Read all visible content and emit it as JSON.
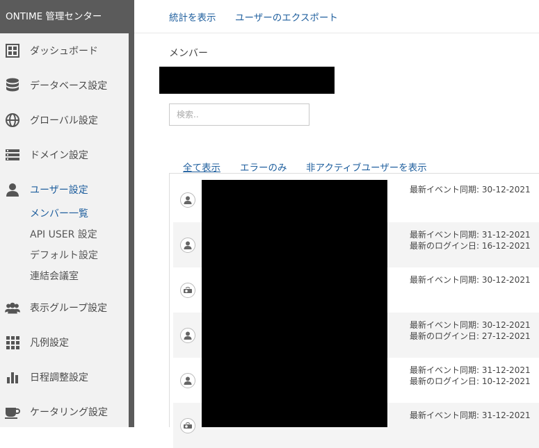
{
  "app": {
    "title": "ONTIME 管理センター"
  },
  "sidebar": {
    "items": [
      {
        "label": "ダッシュボード",
        "icon": "dashboard-icon"
      },
      {
        "label": "データベース設定",
        "icon": "database-icon"
      },
      {
        "label": "グローバル設定",
        "icon": "globe-icon"
      },
      {
        "label": "ドメイン設定",
        "icon": "server-icon"
      },
      {
        "label": "ユーザー設定",
        "icon": "user-icon"
      },
      {
        "label": "表示グループ設定",
        "icon": "group-icon"
      },
      {
        "label": "凡例設定",
        "icon": "grid-icon"
      },
      {
        "label": "日程調整設定",
        "icon": "bar-chart-icon"
      },
      {
        "label": "ケータリング設定",
        "icon": "coffee-icon"
      }
    ],
    "sub_items": [
      {
        "label": "メンバー一覧"
      },
      {
        "label": "API USER 設定"
      },
      {
        "label": "デフォルト設定"
      },
      {
        "label": "連結会議室"
      }
    ]
  },
  "topbar": {
    "links": [
      {
        "label": "統計を表示"
      },
      {
        "label": "ユーザーのエクスポート"
      }
    ]
  },
  "main": {
    "section_title": "メンバー",
    "search": {
      "placeholder": "検索..",
      "value": ""
    },
    "filters": [
      {
        "label": "全て表示"
      },
      {
        "label": "エラーのみ"
      },
      {
        "label": "非アクティブユーザーを表示"
      }
    ],
    "members": [
      {
        "type": "user",
        "last_event_sync": "最新イベント同期: 30-12-2021",
        "last_login": ""
      },
      {
        "type": "user",
        "last_event_sync": "最新イベント同期: 31-12-2021",
        "last_login": "最新のログイン日: 16-12-2021"
      },
      {
        "type": "resource",
        "last_event_sync": "最新イベント同期: 30-12-2021",
        "last_login": ""
      },
      {
        "type": "user",
        "last_event_sync": "最新イベント同期: 30-12-2021",
        "last_login": "最新のログイン日: 27-12-2021"
      },
      {
        "type": "user",
        "last_event_sync": "最新イベント同期: 31-12-2021",
        "last_login": "最新のログイン日: 10-12-2021"
      },
      {
        "type": "resource",
        "last_event_sync": "最新イベント同期: 31-12-2021",
        "last_login": ""
      }
    ]
  },
  "colors": {
    "accent": "#1f5f9e",
    "brand_bar": "#5b5b5b",
    "sidebar_bg": "#f2f2f2"
  }
}
